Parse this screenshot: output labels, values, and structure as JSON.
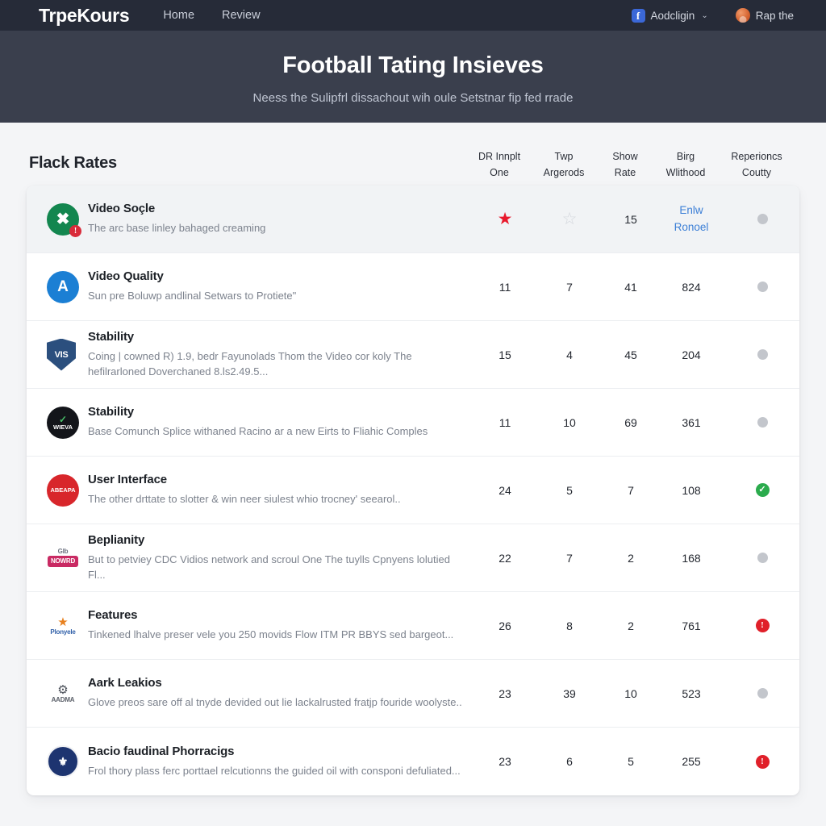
{
  "navbar": {
    "brand": "TrpeKours",
    "links": [
      {
        "label": "Home"
      },
      {
        "label": "Review"
      }
    ],
    "account": {
      "icon": "facebook-icon",
      "icon_glyph": "f",
      "label": "Aodcligin",
      "caret": "⌄"
    },
    "user": {
      "label": "Rap the",
      "avatar": "user-avatar"
    }
  },
  "hero": {
    "title": "Football Tating Insieves",
    "subtitle": "Neess the Sulipfrl dissachout wih oule Setstnar fip fed rrade"
  },
  "section": {
    "title": "Flack Rates",
    "columns": [
      {
        "line1": "DR Innplt",
        "line2": "One"
      },
      {
        "line1": "Twp",
        "line2": "Argerods"
      },
      {
        "line1": "Show",
        "line2": "Rate"
      },
      {
        "line1": "Birg",
        "line2": "Wlithood"
      },
      {
        "line1": "Reperioncs",
        "line2": "Coutty"
      }
    ]
  },
  "colors": {
    "navbar": "#262b38",
    "hero": "#3a3f4d",
    "page": "#f4f5f7",
    "link": "#3c7fd6",
    "star_filled": "#e8192c",
    "status_green": "#2bab4d",
    "status_red": "#e0202a",
    "dot_gray": "#c3c6cc"
  },
  "rows": [
    {
      "highlight": true,
      "logo": {
        "kind": "circle",
        "text": "",
        "bg": "#13864f",
        "mark": "✖",
        "badge": "!"
      },
      "title": "Video Soçle",
      "desc": "The arc base linley bahaged creaming",
      "c0": {
        "type": "star",
        "state": "filled",
        "glyph": "★"
      },
      "c1": {
        "type": "star",
        "state": "empty",
        "glyph": "☆"
      },
      "c2": {
        "type": "text",
        "value": "15"
      },
      "c3": {
        "type": "link",
        "line1": "Enlw",
        "line2": "Ronoel"
      },
      "c4": {
        "type": "dot",
        "state": "gray"
      }
    },
    {
      "highlight": false,
      "logo": {
        "kind": "circle",
        "text": "A",
        "bg": "#1b7fd4",
        "mark": "",
        "badge": ""
      },
      "title": "Video Quality",
      "desc": "Sun pre Boluwp andlinal Setwars to Protiete\"",
      "c0": {
        "type": "text",
        "value": "11"
      },
      "c1": {
        "type": "text",
        "value": "7"
      },
      "c2": {
        "type": "text",
        "value": "41"
      },
      "c3": {
        "type": "text",
        "value": "824"
      },
      "c4": {
        "type": "dot",
        "state": "gray"
      }
    },
    {
      "highlight": false,
      "logo": {
        "kind": "shield",
        "text": "VIS",
        "bg": "#2b4f7e",
        "mark": "",
        "badge": ""
      },
      "title": "Stability",
      "desc": "Coing | cowned R) 1.9, bedr Fayunolads Thom the Video cor koly The hefilrarloned Doverchaned 8.ls2.49.5...",
      "c0": {
        "type": "text",
        "value": "15"
      },
      "c1": {
        "type": "text",
        "value": "4"
      },
      "c2": {
        "type": "text",
        "value": "45"
      },
      "c3": {
        "type": "text",
        "value": "204"
      },
      "c4": {
        "type": "dot",
        "state": "gray"
      }
    },
    {
      "highlight": false,
      "logo": {
        "kind": "circle-text",
        "text": "WIEVA",
        "bg": "#13151a",
        "mark": "✓",
        "badge": ""
      },
      "title": "Stability",
      "desc": "Base Comunch Splice withaned Racino ar a new Eirts to Fliahic Comples",
      "c0": {
        "type": "text",
        "value": "11"
      },
      "c1": {
        "type": "text",
        "value": "10"
      },
      "c2": {
        "type": "text",
        "value": "69"
      },
      "c3": {
        "type": "text",
        "value": "361"
      },
      "c4": {
        "type": "dot",
        "state": "gray"
      }
    },
    {
      "highlight": false,
      "logo": {
        "kind": "circle-text",
        "text": "ABEAPA",
        "bg": "#d8262b",
        "mark": "",
        "badge": ""
      },
      "title": "User Interface",
      "desc": "The other drttate to slotter & win neer siulest whio trocney' seearol..",
      "c0": {
        "type": "text",
        "value": "24"
      },
      "c1": {
        "type": "text",
        "value": "5"
      },
      "c2": {
        "type": "text",
        "value": "7"
      },
      "c3": {
        "type": "text",
        "value": "108"
      },
      "c4": {
        "type": "status",
        "state": "green",
        "glyph": "✓"
      }
    },
    {
      "highlight": false,
      "logo": {
        "kind": "chip",
        "text": "NOWRD",
        "bg": "#c92a63",
        "mark": "GIb",
        "badge": ""
      },
      "title": "Beplianity",
      "desc": "But to petviey CDC Vidios network and scroul One The tuylls Cpnyens lolutied Fl...",
      "c0": {
        "type": "text",
        "value": "22"
      },
      "c1": {
        "type": "text",
        "value": "7"
      },
      "c2": {
        "type": "text",
        "value": "2"
      },
      "c3": {
        "type": "text",
        "value": "168"
      },
      "c4": {
        "type": "dot",
        "state": "gray"
      }
    },
    {
      "highlight": false,
      "logo": {
        "kind": "plain",
        "text": "Plonyele",
        "bg": "transparent",
        "mark": "★",
        "badge": ""
      },
      "title": "Features",
      "desc": "Tinkened lhalve preser vele you 250 movids Flow ITM PR BBYS sed bargeot...",
      "c0": {
        "type": "text",
        "value": "26"
      },
      "c1": {
        "type": "text",
        "value": "8"
      },
      "c2": {
        "type": "text",
        "value": "2"
      },
      "c3": {
        "type": "text",
        "value": "761"
      },
      "c4": {
        "type": "status",
        "state": "red",
        "glyph": "!"
      }
    },
    {
      "highlight": false,
      "logo": {
        "kind": "plain",
        "text": "AADMA",
        "bg": "transparent",
        "mark": "⚙",
        "badge": ""
      },
      "title": "Aark Leakios",
      "desc": "Glove preos sare off al tnyde devided out lie lackalrusted fratjp fouride woolyste..",
      "c0": {
        "type": "text",
        "value": "23"
      },
      "c1": {
        "type": "text",
        "value": "39"
      },
      "c2": {
        "type": "text",
        "value": "10"
      },
      "c3": {
        "type": "text",
        "value": "523"
      },
      "c4": {
        "type": "dot",
        "state": "gray"
      }
    },
    {
      "highlight": false,
      "logo": {
        "kind": "crest",
        "text": "",
        "bg": "#1d3470",
        "mark": "⚜",
        "badge": ""
      },
      "title": "Bacio faudinal Phorracigs",
      "desc": "Frol thory plass ferc porttael relcutionns the guided oil with consponi defuliated...",
      "c0": {
        "type": "text",
        "value": "23"
      },
      "c1": {
        "type": "text",
        "value": "6"
      },
      "c2": {
        "type": "text",
        "value": "5"
      },
      "c3": {
        "type": "text",
        "value": "255"
      },
      "c4": {
        "type": "status",
        "state": "red",
        "glyph": "!"
      }
    }
  ]
}
